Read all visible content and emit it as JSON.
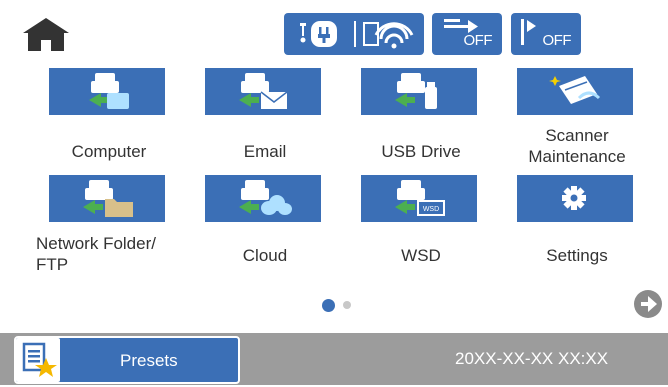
{
  "colors": {
    "accent": "#3b6fb6",
    "bar": "#9c9c9c",
    "text": "#333333",
    "star": "#f5b800"
  },
  "header": {
    "home_icon": "home-icon",
    "status_icons": [
      "network-adapter-icon",
      "wifi-icon"
    ],
    "quick_buttons": [
      {
        "icon": "transfer-off-icon",
        "label": "OFF"
      },
      {
        "icon": "quiet-mode-off-icon",
        "label": "OFF"
      }
    ]
  },
  "menu": {
    "items": [
      {
        "label": "Computer",
        "icon": "scan-to-computer-icon"
      },
      {
        "label": "Email",
        "icon": "scan-to-email-icon"
      },
      {
        "label": "USB Drive",
        "icon": "scan-to-usb-icon"
      },
      {
        "label_lines": [
          "Scanner",
          "Maintenance"
        ],
        "icon": "scanner-maintenance-icon"
      },
      {
        "label_lines": [
          "Network Folder/",
          "FTP"
        ],
        "icon": "scan-to-network-folder-icon"
      },
      {
        "label": "Cloud",
        "icon": "scan-to-cloud-icon"
      },
      {
        "label": "WSD",
        "icon": "scan-to-wsd-icon"
      },
      {
        "label": "Settings",
        "icon": "gear-icon"
      }
    ]
  },
  "pagination": {
    "current_page": 1,
    "total_pages": 2
  },
  "footer": {
    "presets_label": "Presets",
    "datetime": "20XX-XX-XX XX:XX"
  }
}
